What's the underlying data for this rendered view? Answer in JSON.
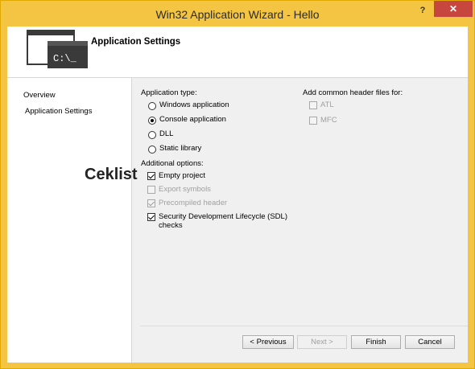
{
  "window": {
    "title": "Win32 Application Wizard - Hello",
    "help_glyph": "?",
    "close_glyph": "✕"
  },
  "header": {
    "title": "Application Settings",
    "icon_prompt": "C:\\_"
  },
  "nav": {
    "items": [
      {
        "label": "Overview"
      },
      {
        "label": "Application Settings",
        "selected": true
      }
    ]
  },
  "application_type": {
    "label": "Application type:",
    "options": [
      {
        "label": "Windows application",
        "selected": false
      },
      {
        "label": "Console application",
        "selected": true
      },
      {
        "label": "DLL",
        "selected": false
      },
      {
        "label": "Static library",
        "selected": false
      }
    ]
  },
  "additional_options": {
    "label": "Additional options:",
    "options": [
      {
        "label": "Empty project",
        "checked": true,
        "enabled": true
      },
      {
        "label": "Export symbols",
        "checked": false,
        "enabled": false
      },
      {
        "label": "Precompiled header",
        "checked": true,
        "enabled": false
      },
      {
        "label": "Security Development Lifecycle (SDL)",
        "label2": "checks",
        "checked": true,
        "enabled": true
      }
    ]
  },
  "common_headers": {
    "label": "Add common header files for:",
    "options": [
      {
        "label": "ATL",
        "checked": false,
        "enabled": false
      },
      {
        "label": "MFC",
        "checked": false,
        "enabled": false
      }
    ]
  },
  "overlay": {
    "text": "Ceklist"
  },
  "buttons": {
    "previous": "< Previous",
    "next": "Next >",
    "finish": "Finish",
    "cancel": "Cancel"
  }
}
